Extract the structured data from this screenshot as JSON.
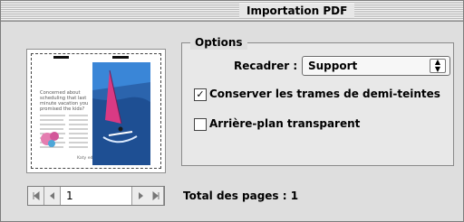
{
  "window": {
    "title": "Importation PDF"
  },
  "preview": {
    "headline": "Concerned about scheduling that last minute vacation you promised the kids?",
    "signature": "Katy edits"
  },
  "navigation": {
    "first_icon": "first-page-icon",
    "prev_icon": "previous-page-icon",
    "page_value": "1",
    "next_icon": "next-page-icon",
    "last_icon": "last-page-icon"
  },
  "options": {
    "label": "Options",
    "crop_label": "Recadrer :",
    "crop_value": "Support",
    "checkbox_halftone": {
      "label": "Conserver les trames de demi-teintes",
      "checked": true
    },
    "checkbox_transparent": {
      "label": "Arrière-plan transparent",
      "checked": false
    }
  },
  "footer": {
    "total_pages": "Total des pages  : 1"
  },
  "colors": {
    "window_bg": "#dedede",
    "group_bg": "#e8e8e8",
    "wind_sail": "#d93a84",
    "sea_blue": "#1f5da8"
  }
}
